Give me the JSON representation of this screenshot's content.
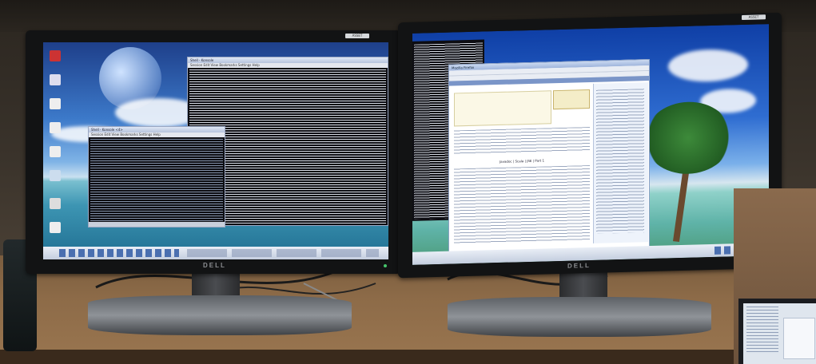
{
  "scene": "dual-monitor-desk",
  "brand_left": "DELL",
  "brand_right": "DELL",
  "left_screen": {
    "terminal_small_title": "Shell - Konsole <4>",
    "terminal_small_menu": "Session  Edit  View  Bookmarks  Settings  Help",
    "terminal_large_title": "Shell - Konsole",
    "terminal_large_menu": "Session  Edit  View  Bookmarks  Settings  Help"
  },
  "right_screen": {
    "browser_title": "Mozilla Firefox",
    "doc_header": "Javadoc | Scala | JSE | Part 1"
  },
  "colors": {
    "bezel": "#121314",
    "desk": "#8d6b48",
    "wall": "#3a332b"
  }
}
